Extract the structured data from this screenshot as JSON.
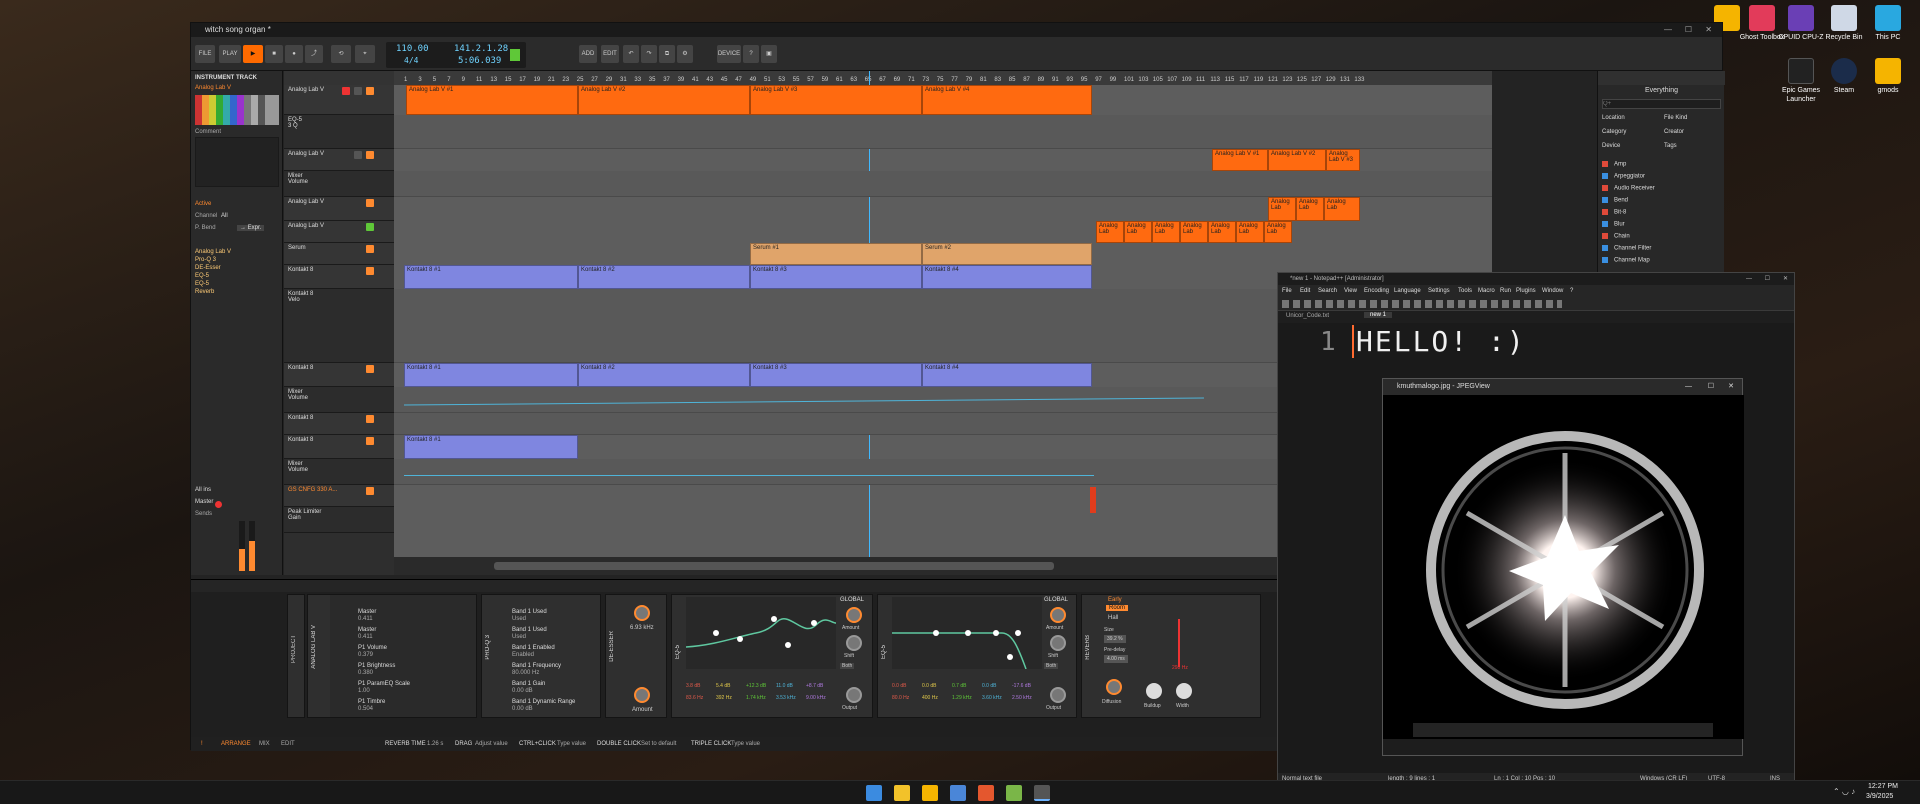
{
  "desktop": {
    "icons": [
      {
        "label": "",
        "color": "#f5b400"
      },
      {
        "label": "Ghost Toolbox",
        "color": "#e23b5a"
      },
      {
        "label": "CPUID CPU-Z",
        "color": "#6a3fb5"
      },
      {
        "label": "Recycle Bin",
        "color": "#cfd8e6"
      },
      {
        "label": "This PC",
        "color": "#29a8e0"
      },
      {
        "label": "Epic Games Launcher",
        "color": "#222222"
      },
      {
        "label": "Steam",
        "color": "#1b2c4a"
      },
      {
        "label": "gmods",
        "color": "#f5b400"
      }
    ]
  },
  "bitwig": {
    "title": "witch song organ *",
    "toolbar": {
      "file": "FILE",
      "play": "PLAY",
      "tempo": "110.00",
      "time_sig": "4/4",
      "position": "141.2.1.28",
      "time": "5:06.039",
      "add": "ADD",
      "edit": "EDIT",
      "device": "DEVICE"
    },
    "inspector": {
      "heading": "INSTRUMENT TRACK",
      "track_name": "Analog Lab V",
      "comment_label": "Comment",
      "active": "Active",
      "channel_label": "Channel",
      "channel_value": "All",
      "bend": "P. Bend",
      "expr": "→ Expr.",
      "devices": [
        "Analog Lab V",
        "Pro-Q 3",
        "DE-Esser",
        "EQ-5",
        "EQ-5",
        "Reverb"
      ],
      "all_ins": "All ins",
      "master": "Master",
      "sends": "Sends"
    },
    "tracks": [
      {
        "name": "Analog Lab V"
      },
      {
        "name": "EQ-5",
        "sub": "3 Q"
      },
      {
        "name": "Analog Lab V"
      },
      {
        "name": "Mixer",
        "sub": "Volume"
      },
      {
        "name": "Analog Lab V"
      },
      {
        "name": "Analog Lab V"
      },
      {
        "name": "Serum"
      },
      {
        "name": "Kontakt 8"
      },
      {
        "name": "Kontakt 8",
        "sub": "Velo"
      },
      {
        "name": "Kontakt 8"
      },
      {
        "name": "Mixer",
        "sub": "Volume"
      },
      {
        "name": "Kontakt 8"
      },
      {
        "name": "Kontakt 8"
      },
      {
        "name": "Mixer",
        "sub": "Volume"
      },
      {
        "name": "GS CNFG 330 A..."
      },
      {
        "name": "Peak Limiter",
        "sub": "Gain"
      }
    ],
    "ruler": [
      "1",
      "3",
      "5",
      "7",
      "9",
      "11",
      "13",
      "15",
      "17",
      "19",
      "21",
      "23",
      "25",
      "27",
      "29",
      "31",
      "33",
      "35",
      "37",
      "39",
      "41",
      "43",
      "45",
      "47",
      "49",
      "51",
      "53",
      "55",
      "57",
      "59",
      "61",
      "63",
      "65",
      "67",
      "69",
      "71",
      "73",
      "75",
      "77",
      "79",
      "81",
      "83",
      "85",
      "87",
      "89",
      "91",
      "93",
      "95",
      "97",
      "99",
      "101",
      "103",
      "105",
      "107",
      "109",
      "111",
      "113",
      "115",
      "117",
      "119",
      "121",
      "123",
      "125",
      "127",
      "129",
      "131",
      "133"
    ],
    "clips": {
      "analog": [
        "Analog Lab V #1",
        "Analog Lab V #2",
        "Analog Lab V #3",
        "Analog Lab V #4"
      ],
      "analog_right": [
        "Analog Lab V #1",
        "Analog Lab V #2",
        "Analog Lab V #3"
      ],
      "serum": [
        "Serum #1",
        "Serum #2"
      ],
      "kontakt_a": [
        "Kontakt 8 #1",
        "Kontakt 8 #2",
        "Kontakt 8 #3",
        "Kontakt 8 #4"
      ],
      "kontakt_b": [
        "Kontakt 8 #1",
        "Kontakt 8 #2",
        "Kontakt 8 #3",
        "Kontakt 8 #4"
      ],
      "kontakt_c": "Kontakt 8 #1",
      "small": [
        "Analog Lab",
        "Analog Lab",
        "Analog Lab",
        "Analog Lab",
        "Analog Lab",
        "Analog Lab",
        "Analog Lab",
        "Analog Lab",
        "Analog Lab",
        "Analog Lab"
      ]
    },
    "browser": {
      "title": "Everything",
      "search_placeholder": "Q+",
      "filters": [
        "Location",
        "File Kind",
        "Category",
        "Creator",
        "Device",
        "Tags"
      ],
      "items": [
        {
          "label": "Amp",
          "color": "#e04a3a"
        },
        {
          "label": "Arpeggiator",
          "color": "#3a8fe0"
        },
        {
          "label": "Audio Receiver",
          "color": "#e04a3a"
        },
        {
          "label": "Bend",
          "color": "#3a8fe0"
        },
        {
          "label": "Bit-8",
          "color": "#e04a3a"
        },
        {
          "label": "Blur",
          "color": "#3a8fe0"
        },
        {
          "label": "Chain",
          "color": "#e04a3a"
        },
        {
          "label": "Channel Filter",
          "color": "#3a8fe0"
        },
        {
          "label": "Channel Map",
          "color": "#3a8fe0"
        }
      ]
    },
    "devices": {
      "project": "PROJECT",
      "analog": "ANALOG LAB V",
      "analog_params": [
        {
          "name": "Master",
          "value": "0.411"
        },
        {
          "name": "Master",
          "value": "0.411"
        },
        {
          "name": "P1 Volume",
          "value": "0.379"
        },
        {
          "name": "P1 Brightness",
          "value": "0.380"
        },
        {
          "name": "P1 ParamEQ Scale",
          "value": "1.00"
        },
        {
          "name": "P1 Timbre",
          "value": "0.504"
        }
      ],
      "proq": "PRO-Q 3",
      "proq_params": [
        {
          "name": "Band 1 Used",
          "value": "Used"
        },
        {
          "name": "Band 1 Used",
          "value": "Used"
        },
        {
          "name": "Band 1 Enabled",
          "value": "Enabled"
        },
        {
          "name": "Band 1 Frequency",
          "value": "80.000 Hz"
        },
        {
          "name": "Band 1 Gain",
          "value": "0.00 dB"
        },
        {
          "name": "Band 1 Dynamic Range",
          "value": "0.00 dB"
        }
      ],
      "deesser": "DE-ESSER",
      "deesser_freq": "6.93 kHz",
      "deesser_amount": "Amount",
      "eq5a": "EQ-5",
      "eq5a_gains": [
        "3.8 dB",
        "5.4 dB",
        "+12.3 dB",
        "11.0 dB",
        "+8.7 dB"
      ],
      "eq5a_freqs": [
        "83.6 Hz",
        "392 Hz",
        "1.74 kHz",
        "3.53 kHz",
        "9.00 kHz"
      ],
      "eq5b": "EQ-5",
      "eq5b_gains": [
        "0.0 dB",
        "0.0 dB",
        "0.7 dB",
        "0.0 dB",
        "-17.6 dB"
      ],
      "eq5b_freqs": [
        "80.0 Hz",
        "400 Hz",
        "1.29 kHz",
        "3.60 kHz",
        "2.50 kHz"
      ],
      "global": "GLOBAL",
      "amount": "Amount",
      "shift": "Shift",
      "output": "Output",
      "both": "Both",
      "reverb": "REVERB",
      "early": "Early",
      "room": "Room",
      "hall": "Hall",
      "size_label": "Size",
      "size_value": "39.2 %",
      "predelay_label": "Pre-delay",
      "predelay_value": "4.00 ms",
      "diffusion": "Diffusion",
      "buildup": "Buildup",
      "width": "Width",
      "freq": "298 Hz"
    },
    "status": {
      "arrange": "ARRANGE",
      "mix": "MIX",
      "edit": "EDIT",
      "reverb_time": "REVERB TIME",
      "reverb_val": "1.26 s",
      "drag": "DRAG",
      "drag_hint": "Adjust value",
      "ctrl": "CTRL+CLICK",
      "ctrl_hint": "Type value",
      "dbl": "DOUBLE CLICK",
      "dbl_hint": "Set to default",
      "triple": "TRIPLE CLICK",
      "triple_hint": "Type value"
    }
  },
  "notepad": {
    "title": "*new 1 - Notepad++ [Administrator]",
    "menu": [
      "File",
      "Edit",
      "Search",
      "View",
      "Encoding",
      "Language",
      "Settings",
      "Tools",
      "Macro",
      "Run",
      "Plugins",
      "Window",
      "?"
    ],
    "tabs": [
      "Unicor_Code.txt",
      "new 1"
    ],
    "line_no": "1",
    "code": "HELLO! :)",
    "status": {
      "type": "Normal text file",
      "length": "length : 9    lines : 1",
      "pos": "Ln : 1    Col : 10    Pos : 10",
      "eol": "Windows (CR LF)",
      "enc": "UTF-8",
      "ins": "INS"
    }
  },
  "viewer": {
    "title": "kmuthmalogo.jpg - JPEGView"
  },
  "taskbar": {
    "time": "12:27 PM",
    "date": "3/9/2025"
  }
}
